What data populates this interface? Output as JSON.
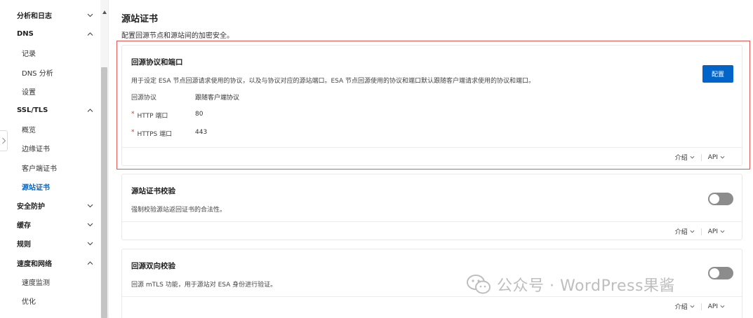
{
  "sidebar": {
    "items": [
      {
        "label": "分析和日志",
        "kind": "group",
        "chevron": "down"
      },
      {
        "label": "DNS",
        "kind": "group",
        "chevron": "up"
      },
      {
        "label": "记录",
        "kind": "sub"
      },
      {
        "label": "DNS 分析",
        "kind": "sub"
      },
      {
        "label": "设置",
        "kind": "sub"
      },
      {
        "label": "SSL/TLS",
        "kind": "group",
        "chevron": "up"
      },
      {
        "label": "概览",
        "kind": "sub"
      },
      {
        "label": "边缘证书",
        "kind": "sub"
      },
      {
        "label": "客户端证书",
        "kind": "sub"
      },
      {
        "label": "源站证书",
        "kind": "sub",
        "active": true
      },
      {
        "label": "安全防护",
        "kind": "group",
        "chevron": "down"
      },
      {
        "label": "缓存",
        "kind": "group",
        "chevron": "down"
      },
      {
        "label": "规则",
        "kind": "group",
        "chevron": "down"
      },
      {
        "label": "速度和网络",
        "kind": "group",
        "chevron": "up"
      },
      {
        "label": "速度监测",
        "kind": "sub"
      },
      {
        "label": "优化",
        "kind": "sub"
      }
    ]
  },
  "page": {
    "title": "源站证书",
    "description": "配置回源节点和源站间的加密安全。"
  },
  "cards": {
    "origin_protocol": {
      "title": "回源协议和端口",
      "description": "用于设定 ESA 节点回源请求使用的协议，以及与协议对应的源站端口。ESA 节点回源使用的协议和端口默认跟随客户端请求使用的协议和端口。",
      "configure_label": "配置",
      "fields": [
        {
          "label": "回源协议",
          "value": "跟随客户端协议",
          "required": false
        },
        {
          "label": "HTTP 端口",
          "value": "80",
          "required": true
        },
        {
          "label": "HTTPS 端口",
          "value": "443",
          "required": true
        }
      ],
      "footer": {
        "intro": "介绍",
        "api": "API"
      }
    },
    "origin_cert_verify": {
      "title": "源站证书校验",
      "description": "强制校验源站返回证书的合法性。",
      "enabled": false,
      "footer": {
        "intro": "介绍",
        "api": "API"
      }
    },
    "mutual_tls": {
      "title": "回源双向校验",
      "description": "回源 mTLS 功能，用于源站对 ESA 身份进行验证。",
      "enabled": false,
      "footer": {
        "intro": "介绍",
        "api": "API"
      }
    }
  },
  "watermark": {
    "text": "公众号 · WordPress果酱",
    "icon": "wechat-icon"
  },
  "colors": {
    "primary": "#0064c8",
    "highlight": "#e05a5a",
    "required": "#d93026",
    "toggle_off": "#8c8c8c"
  }
}
